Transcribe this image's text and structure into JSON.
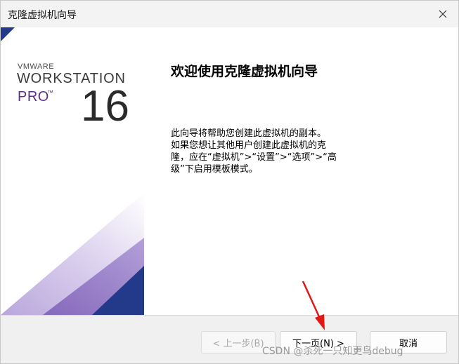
{
  "window": {
    "title": "克隆虚拟机向导"
  },
  "banner": {
    "brand_line1": "VMWARE",
    "brand_line2": "WORKSTATION",
    "brand_line3": "PRO",
    "brand_tm": "™",
    "version": "16",
    "colors": {
      "navy": "#233a8a",
      "purple": "#8d6fc0",
      "lavender": "#cdbfe6"
    }
  },
  "main": {
    "heading": "欢迎使用克隆虚拟机向导",
    "description_lines": [
      "此向导将帮助您创建此虚拟机的副本。",
      "如果您想让其他用户创建此虚拟机的克",
      "隆，应在“虚拟机”>“设置”>“选项”>“高",
      "级”下启用模板模式。"
    ]
  },
  "footer": {
    "back_label": "< 上一步(B)",
    "next_label": "下一页(N) >",
    "cancel_label": "取消"
  },
  "watermark": "CSDN @杀死一只知更鸟debug",
  "icons": {
    "close": "close-icon",
    "annotation_arrow": "red-arrow-icon"
  }
}
